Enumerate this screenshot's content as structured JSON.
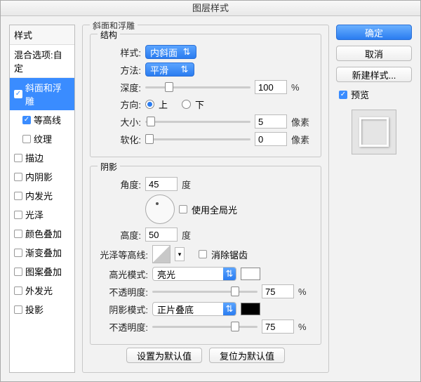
{
  "title": "图层样式",
  "left": {
    "header": "样式",
    "blend": "混合选项:自定",
    "items": [
      {
        "label": "斜面和浮雕",
        "checked": true,
        "selected": true,
        "sub": false
      },
      {
        "label": "等高线",
        "checked": true,
        "selected": false,
        "sub": true
      },
      {
        "label": "纹理",
        "checked": false,
        "selected": false,
        "sub": true
      },
      {
        "label": "描边",
        "checked": false,
        "selected": false,
        "sub": false
      },
      {
        "label": "内阴影",
        "checked": false,
        "selected": false,
        "sub": false
      },
      {
        "label": "内发光",
        "checked": false,
        "selected": false,
        "sub": false
      },
      {
        "label": "光泽",
        "checked": false,
        "selected": false,
        "sub": false
      },
      {
        "label": "颜色叠加",
        "checked": false,
        "selected": false,
        "sub": false
      },
      {
        "label": "渐变叠加",
        "checked": false,
        "selected": false,
        "sub": false
      },
      {
        "label": "图案叠加",
        "checked": false,
        "selected": false,
        "sub": false
      },
      {
        "label": "外发光",
        "checked": false,
        "selected": false,
        "sub": false
      },
      {
        "label": "投影",
        "checked": false,
        "selected": false,
        "sub": false
      }
    ]
  },
  "panel": {
    "title": "斜面和浮雕",
    "structure": {
      "legend": "结构",
      "styleLabel": "样式:",
      "styleValue": "内斜面",
      "methodLabel": "方法:",
      "methodValue": "平滑",
      "depthLabel": "深度:",
      "depthValue": "100",
      "depthUnit": "%",
      "dirLabel": "方向:",
      "dirUp": "上",
      "dirDown": "下",
      "sizeLabel": "大小:",
      "sizeValue": "5",
      "pxUnit": "像素",
      "softenLabel": "软化:",
      "softenValue": "0"
    },
    "shading": {
      "legend": "阴影",
      "angleLabel": "角度:",
      "angleValue": "45",
      "deg": "度",
      "globalLabel": "使用全局光",
      "altLabel": "高度:",
      "altValue": "50",
      "glossLabel": "光泽等高线:",
      "antiAlias": "消除锯齿",
      "hiLabel": "高光模式:",
      "hiValue": "亮光",
      "hiOpacityLabel": "不透明度:",
      "hiOpacity": "75",
      "pct": "%",
      "shLabel": "阴影模式:",
      "shValue": "正片叠底",
      "shOpacityLabel": "不透明度:",
      "shOpacity": "75"
    },
    "defaultsSet": "设置为默认值",
    "defaultsReset": "复位为默认值"
  },
  "right": {
    "ok": "确定",
    "cancel": "取消",
    "newStyle": "新建样式...",
    "preview": "预览"
  }
}
